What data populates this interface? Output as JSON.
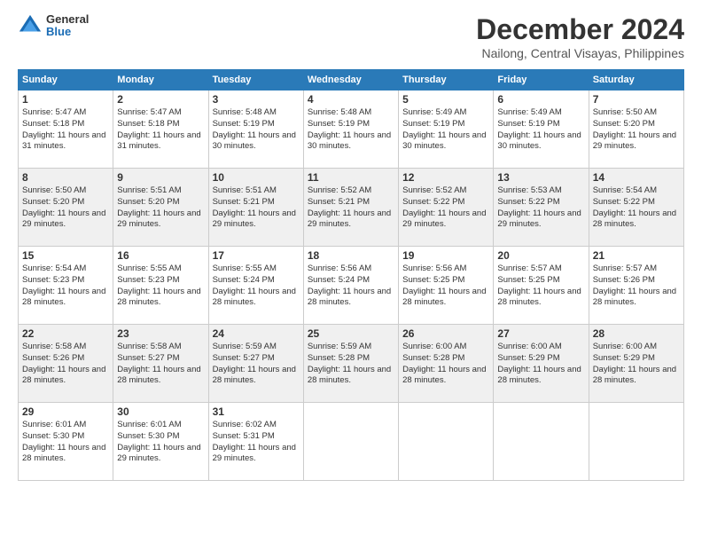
{
  "header": {
    "logo_general": "General",
    "logo_blue": "Blue",
    "month_year": "December 2024",
    "location": "Nailong, Central Visayas, Philippines"
  },
  "days_of_week": [
    "Sunday",
    "Monday",
    "Tuesday",
    "Wednesday",
    "Thursday",
    "Friday",
    "Saturday"
  ],
  "weeks": [
    [
      {
        "day": "1",
        "sunrise": "Sunrise: 5:47 AM",
        "sunset": "Sunset: 5:18 PM",
        "daylight": "Daylight: 11 hours and 31 minutes."
      },
      {
        "day": "2",
        "sunrise": "Sunrise: 5:47 AM",
        "sunset": "Sunset: 5:18 PM",
        "daylight": "Daylight: 11 hours and 31 minutes."
      },
      {
        "day": "3",
        "sunrise": "Sunrise: 5:48 AM",
        "sunset": "Sunset: 5:19 PM",
        "daylight": "Daylight: 11 hours and 30 minutes."
      },
      {
        "day": "4",
        "sunrise": "Sunrise: 5:48 AM",
        "sunset": "Sunset: 5:19 PM",
        "daylight": "Daylight: 11 hours and 30 minutes."
      },
      {
        "day": "5",
        "sunrise": "Sunrise: 5:49 AM",
        "sunset": "Sunset: 5:19 PM",
        "daylight": "Daylight: 11 hours and 30 minutes."
      },
      {
        "day": "6",
        "sunrise": "Sunrise: 5:49 AM",
        "sunset": "Sunset: 5:19 PM",
        "daylight": "Daylight: 11 hours and 30 minutes."
      },
      {
        "day": "7",
        "sunrise": "Sunrise: 5:50 AM",
        "sunset": "Sunset: 5:20 PM",
        "daylight": "Daylight: 11 hours and 29 minutes."
      }
    ],
    [
      {
        "day": "8",
        "sunrise": "Sunrise: 5:50 AM",
        "sunset": "Sunset: 5:20 PM",
        "daylight": "Daylight: 11 hours and 29 minutes."
      },
      {
        "day": "9",
        "sunrise": "Sunrise: 5:51 AM",
        "sunset": "Sunset: 5:20 PM",
        "daylight": "Daylight: 11 hours and 29 minutes."
      },
      {
        "day": "10",
        "sunrise": "Sunrise: 5:51 AM",
        "sunset": "Sunset: 5:21 PM",
        "daylight": "Daylight: 11 hours and 29 minutes."
      },
      {
        "day": "11",
        "sunrise": "Sunrise: 5:52 AM",
        "sunset": "Sunset: 5:21 PM",
        "daylight": "Daylight: 11 hours and 29 minutes."
      },
      {
        "day": "12",
        "sunrise": "Sunrise: 5:52 AM",
        "sunset": "Sunset: 5:22 PM",
        "daylight": "Daylight: 11 hours and 29 minutes."
      },
      {
        "day": "13",
        "sunrise": "Sunrise: 5:53 AM",
        "sunset": "Sunset: 5:22 PM",
        "daylight": "Daylight: 11 hours and 29 minutes."
      },
      {
        "day": "14",
        "sunrise": "Sunrise: 5:54 AM",
        "sunset": "Sunset: 5:22 PM",
        "daylight": "Daylight: 11 hours and 28 minutes."
      }
    ],
    [
      {
        "day": "15",
        "sunrise": "Sunrise: 5:54 AM",
        "sunset": "Sunset: 5:23 PM",
        "daylight": "Daylight: 11 hours and 28 minutes."
      },
      {
        "day": "16",
        "sunrise": "Sunrise: 5:55 AM",
        "sunset": "Sunset: 5:23 PM",
        "daylight": "Daylight: 11 hours and 28 minutes."
      },
      {
        "day": "17",
        "sunrise": "Sunrise: 5:55 AM",
        "sunset": "Sunset: 5:24 PM",
        "daylight": "Daylight: 11 hours and 28 minutes."
      },
      {
        "day": "18",
        "sunrise": "Sunrise: 5:56 AM",
        "sunset": "Sunset: 5:24 PM",
        "daylight": "Daylight: 11 hours and 28 minutes."
      },
      {
        "day": "19",
        "sunrise": "Sunrise: 5:56 AM",
        "sunset": "Sunset: 5:25 PM",
        "daylight": "Daylight: 11 hours and 28 minutes."
      },
      {
        "day": "20",
        "sunrise": "Sunrise: 5:57 AM",
        "sunset": "Sunset: 5:25 PM",
        "daylight": "Daylight: 11 hours and 28 minutes."
      },
      {
        "day": "21",
        "sunrise": "Sunrise: 5:57 AM",
        "sunset": "Sunset: 5:26 PM",
        "daylight": "Daylight: 11 hours and 28 minutes."
      }
    ],
    [
      {
        "day": "22",
        "sunrise": "Sunrise: 5:58 AM",
        "sunset": "Sunset: 5:26 PM",
        "daylight": "Daylight: 11 hours and 28 minutes."
      },
      {
        "day": "23",
        "sunrise": "Sunrise: 5:58 AM",
        "sunset": "Sunset: 5:27 PM",
        "daylight": "Daylight: 11 hours and 28 minutes."
      },
      {
        "day": "24",
        "sunrise": "Sunrise: 5:59 AM",
        "sunset": "Sunset: 5:27 PM",
        "daylight": "Daylight: 11 hours and 28 minutes."
      },
      {
        "day": "25",
        "sunrise": "Sunrise: 5:59 AM",
        "sunset": "Sunset: 5:28 PM",
        "daylight": "Daylight: 11 hours and 28 minutes."
      },
      {
        "day": "26",
        "sunrise": "Sunrise: 6:00 AM",
        "sunset": "Sunset: 5:28 PM",
        "daylight": "Daylight: 11 hours and 28 minutes."
      },
      {
        "day": "27",
        "sunrise": "Sunrise: 6:00 AM",
        "sunset": "Sunset: 5:29 PM",
        "daylight": "Daylight: 11 hours and 28 minutes."
      },
      {
        "day": "28",
        "sunrise": "Sunrise: 6:00 AM",
        "sunset": "Sunset: 5:29 PM",
        "daylight": "Daylight: 11 hours and 28 minutes."
      }
    ],
    [
      {
        "day": "29",
        "sunrise": "Sunrise: 6:01 AM",
        "sunset": "Sunset: 5:30 PM",
        "daylight": "Daylight: 11 hours and 28 minutes."
      },
      {
        "day": "30",
        "sunrise": "Sunrise: 6:01 AM",
        "sunset": "Sunset: 5:30 PM",
        "daylight": "Daylight: 11 hours and 29 minutes."
      },
      {
        "day": "31",
        "sunrise": "Sunrise: 6:02 AM",
        "sunset": "Sunset: 5:31 PM",
        "daylight": "Daylight: 11 hours and 29 minutes."
      },
      null,
      null,
      null,
      null
    ]
  ]
}
